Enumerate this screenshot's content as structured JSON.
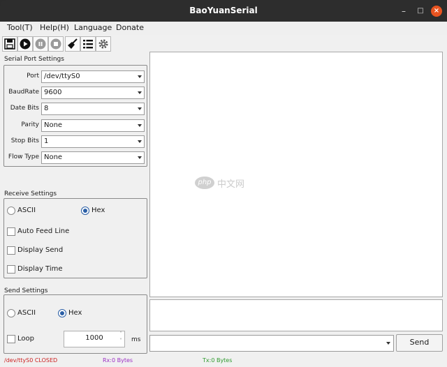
{
  "window": {
    "title": "BaoYuanSerial",
    "minimize": "–",
    "maximize": "□",
    "close": "×"
  },
  "menu": [
    "Tool(T)",
    "Help(H)",
    "Language",
    "Donate"
  ],
  "toolbar": [
    "save-icon",
    "play-icon",
    "pause-icon",
    "stop-icon",
    "broom-icon",
    "list-icon",
    "gear-icon"
  ],
  "serial": {
    "title": "Serial Port Settings",
    "port_label": "Port",
    "port_value": "/dev/ttyS0",
    "baud_label": "BaudRate",
    "baud_value": "9600",
    "databits_label": "Date Bits",
    "databits_value": "8",
    "parity_label": "Parity",
    "parity_value": "None",
    "stopbits_label": "Stop Bits",
    "stopbits_value": "1",
    "flow_label": "Flow Type",
    "flow_value": "None"
  },
  "receive": {
    "title": "Receive Settings",
    "ascii": "ASCII",
    "hex": "Hex",
    "auto_feed": "Auto Feed Line",
    "display_send": "Display Send",
    "display_time": "Display Time"
  },
  "send": {
    "title": "Send Settings",
    "ascii": "ASCII",
    "hex": "Hex",
    "loop": "Loop",
    "interval": "1000",
    "unit": "ms",
    "button": "Send"
  },
  "status": {
    "port": "/dev/ttyS0 CLOSED",
    "rx": "Rx:0 Bytes",
    "tx": "Tx:0 Bytes"
  },
  "watermark": {
    "brand": "php",
    "cn": "中文网"
  }
}
